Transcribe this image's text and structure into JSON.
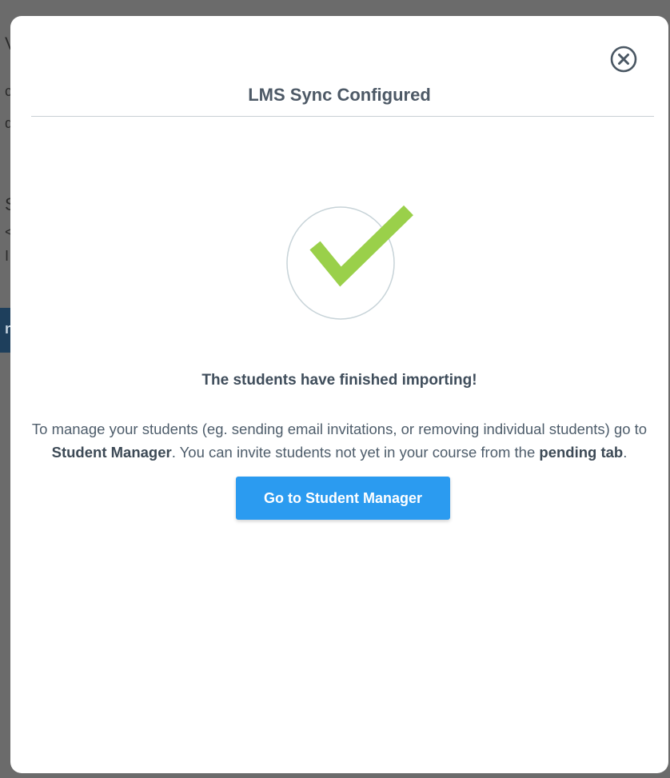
{
  "background": {
    "fragments": [
      "V",
      "c",
      "d",
      "S",
      "<",
      "I"
    ],
    "bar_text": "n"
  },
  "modal": {
    "title": "LMS Sync Configured",
    "close_icon": "close-circle-icon",
    "success_icon": "checkmark-icon",
    "heading": "The students have finished importing!",
    "message": {
      "part1": "To manage your students (eg. sending email invitations, or removing individual students) go to ",
      "strong1": "Student Manager",
      "part2": ". You can invite students not yet in your course from the ",
      "strong2": "pending tab",
      "part3": "."
    },
    "button_label": "Go to Student Manager"
  },
  "colors": {
    "accent": "#2b9bf0",
    "check": "#9ad04a",
    "circle": "#c7d3d8",
    "text": "#4d5966"
  }
}
